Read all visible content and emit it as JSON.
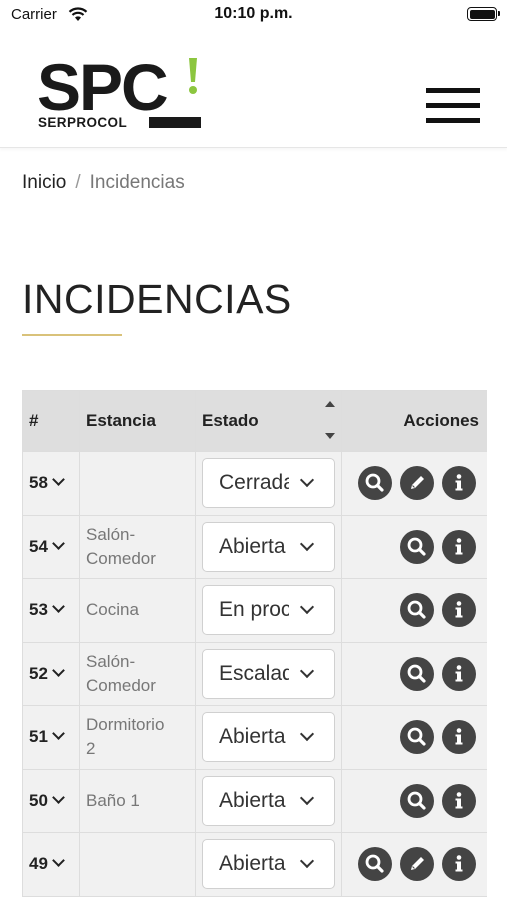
{
  "status_bar": {
    "carrier": "Carrier",
    "time": "10:10 p.m."
  },
  "header": {
    "logo": {
      "mark": "SPC",
      "subtitle": "SERPROCOL",
      "accent_color": "#8cc63f"
    }
  },
  "breadcrumb": {
    "home": "Inicio",
    "separator": "/",
    "current": "Incidencias"
  },
  "page": {
    "title": "INCIDENCIAS",
    "underline_color": "#d9c27a"
  },
  "table": {
    "columns": {
      "num": "#",
      "estancia": "Estancia",
      "estado": "Estado",
      "acciones": "Acciones"
    },
    "rows": [
      {
        "num": "58",
        "estancia_1": "",
        "estancia_2": "",
        "estado": "Cerrada",
        "actions": [
          "search-icon",
          "edit-icon",
          "info-icon"
        ]
      },
      {
        "num": "54",
        "estancia_1": "Salón-",
        "estancia_2": "Comedor",
        "estado": "Abierta",
        "actions": [
          "search-icon",
          "info-icon"
        ]
      },
      {
        "num": "53",
        "estancia_1": "Cocina",
        "estancia_2": "",
        "estado": "En proceso",
        "actions": [
          "search-icon",
          "info-icon"
        ]
      },
      {
        "num": "52",
        "estancia_1": "Salón-",
        "estancia_2": "Comedor",
        "estado": "Escalada",
        "actions": [
          "search-icon",
          "info-icon"
        ]
      },
      {
        "num": "51",
        "estancia_1": "Dormitorio",
        "estancia_2": "2",
        "estado": "Abierta",
        "actions": [
          "search-icon",
          "info-icon"
        ]
      },
      {
        "num": "50",
        "estancia_1": "Baño 1",
        "estancia_2": "",
        "estado": "Abierta",
        "actions": [
          "search-icon",
          "info-icon"
        ]
      },
      {
        "num": "49",
        "estancia_1": "",
        "estancia_2": "",
        "estado": "Abierta",
        "actions": [
          "search-icon",
          "edit-icon",
          "info-icon"
        ]
      }
    ]
  },
  "colors": {
    "header_bg": "#dedede",
    "row_bg": "#f1f1f1",
    "action_icon_bg": "#444444"
  }
}
